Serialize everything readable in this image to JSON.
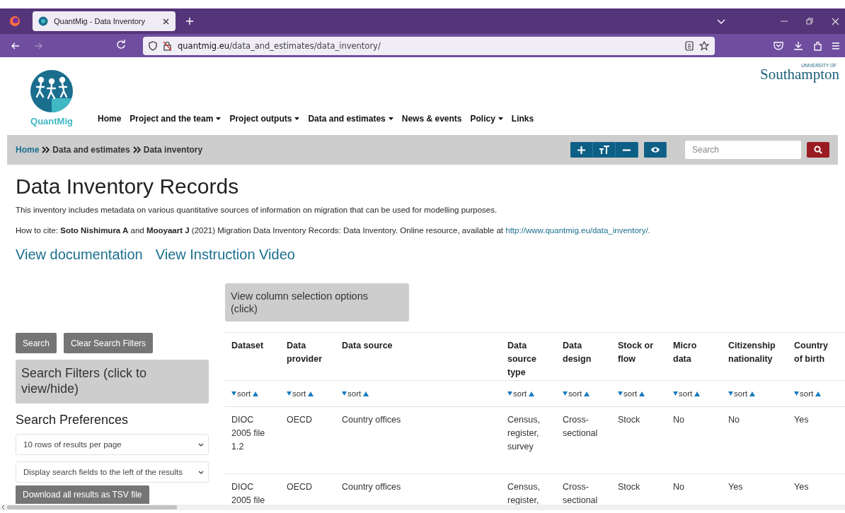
{
  "browser": {
    "tab_title": "QuantMig - Data Inventory",
    "url_domain": "quantmig.eu",
    "url_path": "/data_and_estimates/data_inventory/",
    "forward_disabled": true
  },
  "site": {
    "logo_text": "QuantMig",
    "nav": [
      {
        "label": "Home",
        "dropdown": false
      },
      {
        "label": "Project and the team",
        "dropdown": true
      },
      {
        "label": "Project outputs",
        "dropdown": true
      },
      {
        "label": "Data and estimates",
        "dropdown": true
      },
      {
        "label": "News & events",
        "dropdown": false
      },
      {
        "label": "Policy",
        "dropdown": true
      },
      {
        "label": "Links",
        "dropdown": false
      }
    ],
    "partner": {
      "small": "UNIVERSITY OF",
      "name": "Southampton"
    }
  },
  "breadcrumb": [
    {
      "label": "Home",
      "link": true
    },
    {
      "label": "Data and estimates",
      "link": false
    },
    {
      "label": "Data inventory",
      "link": false
    }
  ],
  "site_search": {
    "placeholder": "Search"
  },
  "page": {
    "title": "Data Inventory Records",
    "intro": "This inventory includes metadata on various quantitative sources of information on migration that can be used for modelling purposes.",
    "citation": "How to cite: **Soto Nishimura A** and **Mooyaart J** (2021) Migration Data Inventory Records: Data Inventory. Online resource, available at",
    "citation_link": "http://www.quantmig.eu/data_inventory/.",
    "links": [
      "View documentation",
      "View Instruction Video"
    ]
  },
  "sidebar": {
    "buttons": [
      "Search",
      "Clear Search Filters"
    ],
    "filters_toggle": "Search Filters (click to view/hide)",
    "preferences_heading": "Search Preferences",
    "selects": [
      "10 rows of results per page",
      "Display search fields to the left of the results"
    ],
    "download": "Download all results as TSV file"
  },
  "table": {
    "column_options": "View column selection options (click)",
    "columns": [
      {
        "label": "Dataset",
        "sort": "sort"
      },
      {
        "label": "Data provider",
        "sort": "sort"
      },
      {
        "label": "Data source",
        "sort": "sort"
      },
      {
        "label": "Data source type",
        "sort": "sort"
      },
      {
        "label": "Data design",
        "sort": "sort"
      },
      {
        "label": "Stock or flow",
        "sort": "sort"
      },
      {
        "label": "Micro data",
        "sort": "sort"
      },
      {
        "label": "Citizenship nationality",
        "sort": "sort"
      },
      {
        "label": "Country of birth",
        "sort": "sort"
      }
    ],
    "rows": [
      [
        "DIOC 2005 file 1.2",
        "OECD",
        "Country offices",
        "Census, register, survey",
        "Cross-sectional",
        "Stock",
        "No",
        "No",
        "Yes"
      ],
      [
        "DIOC 2005 file",
        "OECD",
        "Country offices",
        "Census, register,",
        "Cross-sectional",
        "Stock",
        "No",
        "Yes",
        "Yes"
      ]
    ]
  }
}
